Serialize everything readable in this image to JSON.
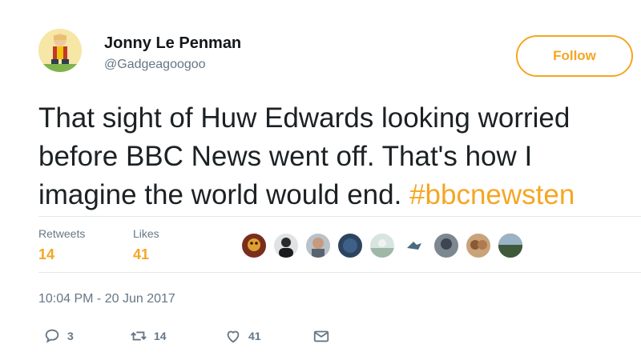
{
  "author": {
    "name": "Jonny Le Penman",
    "handle": "@Gadgeagoogoo"
  },
  "follow_label": "Follow",
  "tweet": {
    "lines": [
      "That sight of Huw Edwards looking worried",
      "before BBC News went off. That's how I",
      "imagine the world would end. "
    ],
    "hashtag": "#bbcnewsten"
  },
  "stats": {
    "retweets_label": "Retweets",
    "retweets_value": "14",
    "likes_label": "Likes",
    "likes_value": "41"
  },
  "timestamp": "10:04 PM - 20 Jun 2017",
  "actions": {
    "reply_count": "3",
    "retweet_count": "14",
    "like_count": "41"
  },
  "colors": {
    "accent": "#f5a623",
    "muted": "#657786"
  }
}
